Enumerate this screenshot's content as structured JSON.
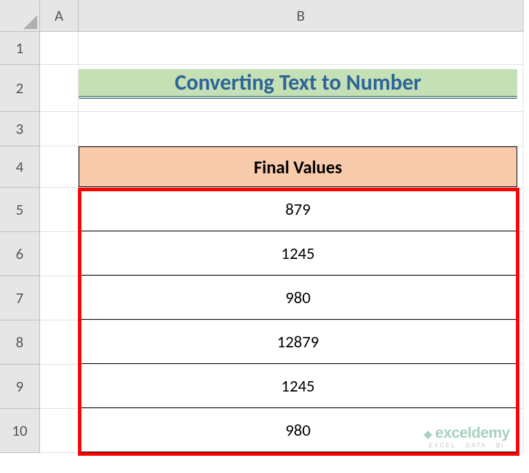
{
  "columns": [
    "A",
    "B"
  ],
  "rows": [
    "1",
    "2",
    "3",
    "4",
    "5",
    "6",
    "7",
    "8",
    "9",
    "10"
  ],
  "title": "Converting Text to Number",
  "table_header": "Final Values",
  "data_values": [
    "879",
    "1245",
    "980",
    "12879",
    "1245",
    "980"
  ],
  "watermark": {
    "brand": "exceldemy",
    "tagline": "EXCEL · DATA · BI"
  },
  "chart_data": {
    "type": "table",
    "title": "Converting Text to Number",
    "columns": [
      "Final Values"
    ],
    "rows": [
      [
        879
      ],
      [
        1245
      ],
      [
        980
      ],
      [
        12879
      ],
      [
        1245
      ],
      [
        980
      ]
    ]
  }
}
